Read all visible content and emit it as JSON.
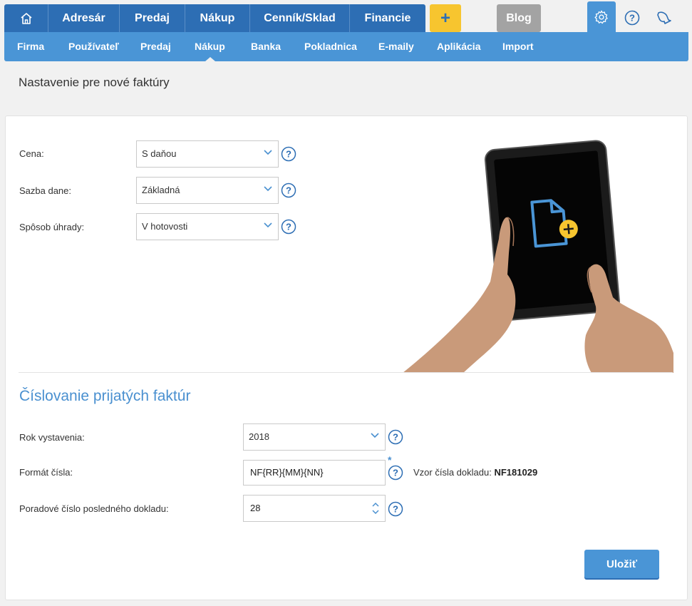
{
  "topnav": {
    "items": [
      {
        "label": "Adresár"
      },
      {
        "label": "Predaj"
      },
      {
        "label": "Nákup"
      },
      {
        "label": "Cenník/Sklad"
      },
      {
        "label": "Financie"
      }
    ],
    "plus_label": "+",
    "blog_label": "Blog"
  },
  "subnav": {
    "items": [
      {
        "label": "Firma"
      },
      {
        "label": "Používateľ"
      },
      {
        "label": "Predaj"
      },
      {
        "label": "Nákup",
        "active": true
      },
      {
        "label": "Banka"
      },
      {
        "label": "Pokladnica"
      },
      {
        "label": "E-maily"
      },
      {
        "label": "Aplikácia"
      },
      {
        "label": "Import"
      }
    ]
  },
  "page_title": "Nastavenie pre nové faktúry",
  "settings": {
    "price": {
      "label": "Cena:",
      "value": "S daňou"
    },
    "tax": {
      "label": "Sazba dane:",
      "value": "Základná"
    },
    "payment": {
      "label": "Spôsob úhrady:",
      "value": "V hotovosti"
    }
  },
  "numbering": {
    "title": "Číslovanie prijatých faktúr",
    "year": {
      "label": "Rok vystavenia:",
      "value": "2018"
    },
    "format": {
      "label": "Formát čísla:",
      "value": "NF{RR}{MM}{NN}",
      "required_mark": "*"
    },
    "preview_label": "Vzor čísla dokladu:",
    "preview_value": "NF181029",
    "last_number": {
      "label": "Poradové číslo posledného dokladu:",
      "value": "28"
    }
  },
  "save_label": "Uložiť",
  "icons": {
    "home": "home-icon",
    "gear": "gear-icon",
    "help": "help-icon",
    "bell": "bell-icon",
    "chevron": "chevron-down-icon",
    "spinner": "spinner-icon"
  },
  "colors": {
    "primary": "#2d6eb4",
    "secondary": "#4a95d6",
    "accent": "#f7c52f",
    "blog": "#a3a3a3"
  }
}
